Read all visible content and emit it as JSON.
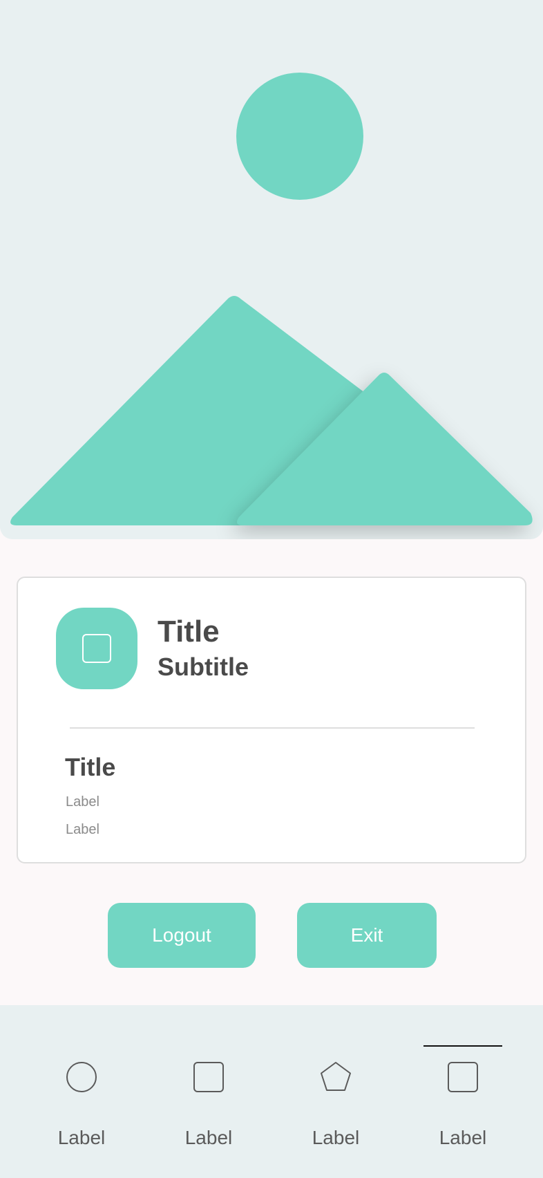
{
  "colors": {
    "accent": "#72d6c3",
    "hero_bg": "#e8f0f1",
    "page_bg": "#fcf8f9",
    "text_dark": "#4a4a4a",
    "text_muted": "#8a8a8a"
  },
  "hero": {
    "icon": "image-placeholder-icon"
  },
  "card": {
    "avatar_icon": "square-icon",
    "title": "Title",
    "subtitle": "Subtitle",
    "section_title": "Title",
    "labels": [
      "Label",
      "Label"
    ]
  },
  "buttons": {
    "logout_label": "Logout",
    "exit_label": "Exit"
  },
  "bottom_nav": {
    "active_index": 3,
    "items": [
      {
        "label": "Label",
        "icon": "circle-icon"
      },
      {
        "label": "Label",
        "icon": "square-icon"
      },
      {
        "label": "Label",
        "icon": "pentagon-icon"
      },
      {
        "label": "Label",
        "icon": "square-icon"
      }
    ]
  }
}
